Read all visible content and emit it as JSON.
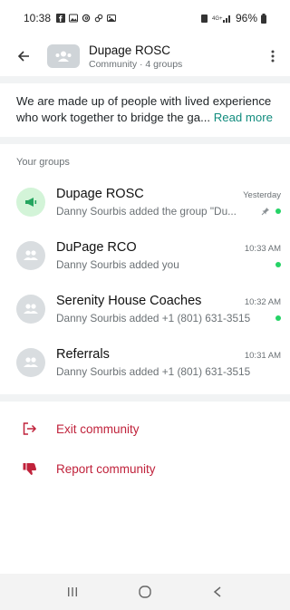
{
  "status_bar": {
    "time": "10:38",
    "battery": "96%",
    "icons": [
      "facebook-icon",
      "gallery-icon",
      "threads-icon",
      "link-icon",
      "image-icon"
    ],
    "right_icons": [
      "alarm-icon",
      "volte-icon",
      "signal-icon",
      "battery-icon"
    ]
  },
  "header": {
    "title": "Dupage ROSC",
    "subtitle": "Community · 4 groups"
  },
  "about": {
    "text": "We are made up of people with lived experience who work together to bridge the ga...",
    "read_more": "Read more"
  },
  "groups_section": {
    "label": "Your groups",
    "items": [
      {
        "name": "Dupage ROSC",
        "time": "Yesterday",
        "message": "Danny Sourbis added the group \"Du...",
        "avatar": "megaphone-icon",
        "pinned": true,
        "unread": true
      },
      {
        "name": "DuPage RCO",
        "time": "10:33 AM",
        "message": "Danny Sourbis added you",
        "avatar": "group-icon",
        "pinned": false,
        "unread": true
      },
      {
        "name": "Serenity House Coaches",
        "time": "10:32 AM",
        "message": "Danny Sourbis added +1 (801) 631-3515",
        "avatar": "group-icon",
        "pinned": false,
        "unread": true
      },
      {
        "name": "Referrals",
        "time": "10:31 AM",
        "message": "Danny Sourbis added +1 (801) 631-3515",
        "avatar": "group-icon",
        "pinned": false,
        "unread": false
      }
    ]
  },
  "actions": {
    "exit": "Exit community",
    "report": "Report community"
  },
  "colors": {
    "accent": "#128c7e",
    "danger": "#c0223b",
    "unread_dot": "#25d366"
  }
}
